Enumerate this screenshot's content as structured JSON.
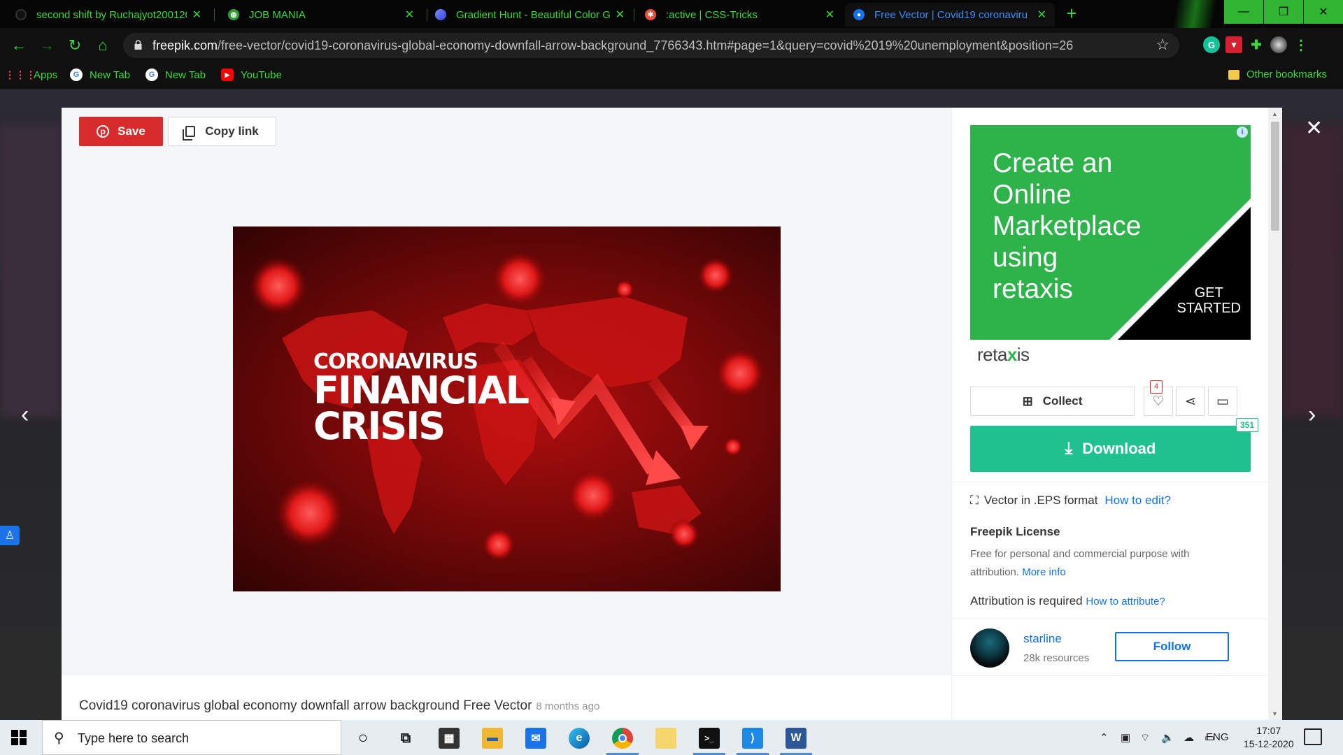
{
  "browser": {
    "tabs": [
      {
        "title": "second shift by Ruchajyot200120",
        "favicon": "github-icon"
      },
      {
        "title": "JOB MANIA",
        "favicon": "globe-icon"
      },
      {
        "title": "Gradient Hunt - Beautiful Color G",
        "favicon": "gradient-hunt-icon"
      },
      {
        "title": ":active | CSS-Tricks",
        "favicon": "css-tricks-icon"
      },
      {
        "title": "Free Vector | Covid19 coronaviru",
        "favicon": "freepik-icon",
        "active": true
      }
    ],
    "url_domain": "freepik.com",
    "url_path": "/free-vector/covid19-coronavirus-global-economy-downfall-arrow-background_7766343.htm#page=1&query=covid%2019%20unemployment&position=26",
    "bookmarks": [
      {
        "label": "Apps",
        "icon": "apps-grid-icon"
      },
      {
        "label": "New Tab",
        "icon": "google-icon"
      },
      {
        "label": "New Tab",
        "icon": "google-icon"
      },
      {
        "label": "YouTube",
        "icon": "youtube-icon"
      }
    ],
    "other_bookmarks": "Other bookmarks",
    "accent_color": "#3bd93b"
  },
  "toolbar": {
    "save_label": "Save",
    "copy_link_label": "Copy link"
  },
  "image": {
    "line1": "CORONAVIRUS",
    "line2": "FINANCIAL",
    "line3": "CRISIS"
  },
  "caption": {
    "title": "Covid19 coronavirus global economy downfall arrow background Free Vector",
    "ago": "8 months ago"
  },
  "ad": {
    "text_lines": [
      "Create an",
      "Online",
      "Marketplace",
      "using",
      "retaxis"
    ],
    "cta_lines": [
      "GET",
      "STARTED"
    ],
    "logo_pre": "reta",
    "logo_x": "x",
    "logo_post": "is",
    "brand_color": "#2db34a"
  },
  "actions": {
    "collect_label": "Collect",
    "likes_count": "4",
    "download_label": "Download",
    "download_count": "351",
    "download_color": "#1fc28e"
  },
  "info": {
    "format_text": "Vector in .EPS format",
    "how_to_edit": "How to edit?",
    "license_title": "Freepik License",
    "license_desc": "Free for personal and commercial purpose with attribution.",
    "more_info": "More info",
    "attribution_text": "Attribution is required",
    "how_to_attribute": "How to attribute?"
  },
  "author": {
    "name": "starline",
    "resources": "28k resources",
    "follow_label": "Follow"
  },
  "taskbar": {
    "search_placeholder": "Type here to search",
    "language": "ENG",
    "time": "17:07",
    "date": "15-12-2020"
  }
}
